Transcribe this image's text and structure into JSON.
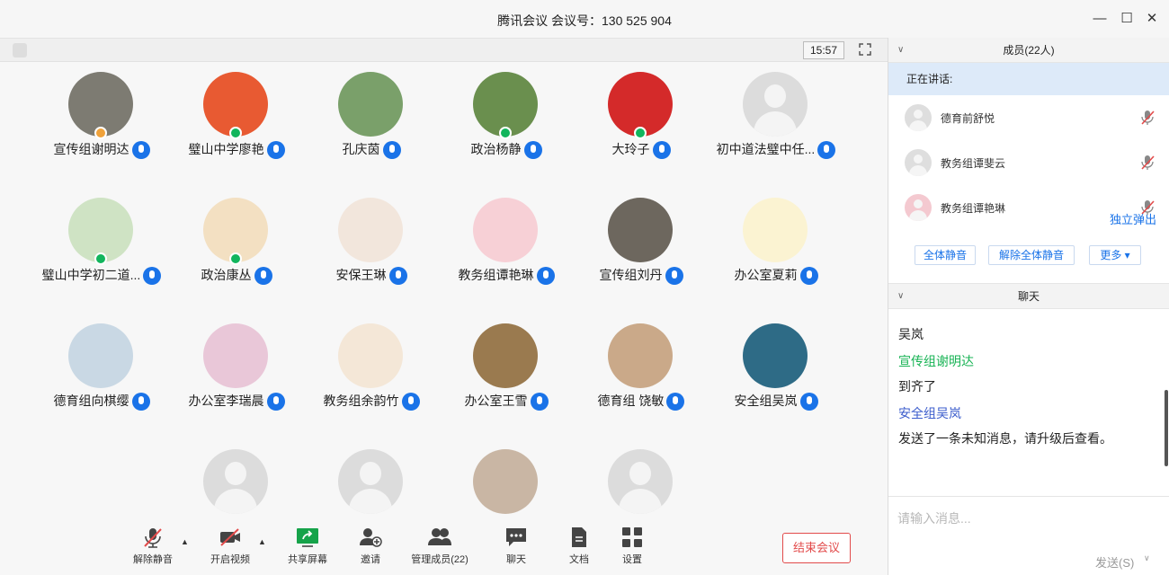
{
  "window": {
    "title": "腾讯会议 会议号：130 525 904",
    "minimize_glyph": "—",
    "maximize_glyph": "☐",
    "close_glyph": "✕"
  },
  "meeting": {
    "clock": "15:57"
  },
  "participants": [
    {
      "name": "宣传组谢明达",
      "avatar_color": "#7d7b72",
      "badge": "orange"
    },
    {
      "name": "璧山中学廖艳",
      "avatar_color": "#e85a32",
      "badge": "green"
    },
    {
      "name": "孔庆茵",
      "avatar_color": "#7aa06a",
      "badge": "none"
    },
    {
      "name": "政治杨静",
      "avatar_color": "#6a8f4e",
      "badge": "green"
    },
    {
      "name": "大玲子",
      "avatar_color": "#d42a2a",
      "badge": "green"
    },
    {
      "name": "初中道法璧中任...",
      "avatar_color": "#dcdcdc",
      "badge": "none"
    },
    {
      "name": "璧山中学初二道...",
      "avatar_color": "#cfe3c4",
      "badge": "green"
    },
    {
      "name": "政治康丛",
      "avatar_color": "#f3e0c2",
      "badge": "green"
    },
    {
      "name": "安保王琳",
      "avatar_color": "#f2e6dc",
      "badge": "none"
    },
    {
      "name": "教务组谭艳琳",
      "avatar_color": "#f7d0d6",
      "badge": "none"
    },
    {
      "name": "宣传组刘丹",
      "avatar_color": "#6d675e",
      "badge": "none"
    },
    {
      "name": "办公室夏莉",
      "avatar_color": "#fbf3d2",
      "badge": "none"
    },
    {
      "name": "德育组向棋缨",
      "avatar_color": "#c9d8e4",
      "badge": "none"
    },
    {
      "name": "办公室李瑞晨",
      "avatar_color": "#e9c7d8",
      "badge": "none"
    },
    {
      "name": "教务组余韵竹",
      "avatar_color": "#f4e7d7",
      "badge": "none"
    },
    {
      "name": "办公室王雪",
      "avatar_color": "#9a7a4f",
      "badge": "none"
    },
    {
      "name": "德育组  饶敏",
      "avatar_color": "#caa989",
      "badge": "none"
    },
    {
      "name": "安全组吴岚",
      "avatar_color": "#2e6b86",
      "badge": "none"
    },
    {
      "name": "",
      "avatar_color": "#dcdcdc",
      "badge": "none"
    },
    {
      "name": "",
      "avatar_color": "#dcdcdc",
      "badge": "none"
    },
    {
      "name": "",
      "avatar_color": "#c9b6a4",
      "badge": "none"
    },
    {
      "name": "",
      "avatar_color": "#dcdcdc",
      "badge": "none"
    }
  ],
  "toolbar": {
    "unmute": "解除静音",
    "start_video": "开启视频",
    "share_screen": "共享屏幕",
    "invite": "邀请",
    "manage_members": "管理成员(22)",
    "chat": "聊天",
    "docs": "文档",
    "settings": "设置",
    "end_meeting": "结束会议"
  },
  "sidebar": {
    "members_header": "成员(22人)",
    "speaking_label": "正在讲话:",
    "members": [
      {
        "name": "德育前舒悦",
        "avatar_color": "#dedede"
      },
      {
        "name": "教务组谭斐云",
        "avatar_color": "#dedede"
      },
      {
        "name": "教务组谭艳琳",
        "avatar_color": "#f4c9d0"
      }
    ],
    "mute_all": "全体静音",
    "unmute_all": "解除全体静音",
    "more": "更多 ▾",
    "chat_header": "聊天",
    "chat_lines": [
      {
        "text": "吴岚",
        "style": "normal"
      },
      {
        "text": "宣传组谢明达",
        "style": "green"
      },
      {
        "text": "到齐了",
        "style": "normal"
      },
      {
        "text": "安全组吴岚",
        "style": "blue"
      },
      {
        "text": "发送了一条未知消息，请升级后查看。",
        "style": "normal"
      }
    ],
    "popout": "独立弹出",
    "input_placeholder": "请输入消息...",
    "send": "发送(S)",
    "send_caret": "∨"
  },
  "colors": {
    "accent_blue": "#1a73e8",
    "speaking_bg": "#ddeaf9",
    "end_red": "#e24b4b",
    "chat_green": "#17b354",
    "chat_blue": "#3b5ccc"
  }
}
